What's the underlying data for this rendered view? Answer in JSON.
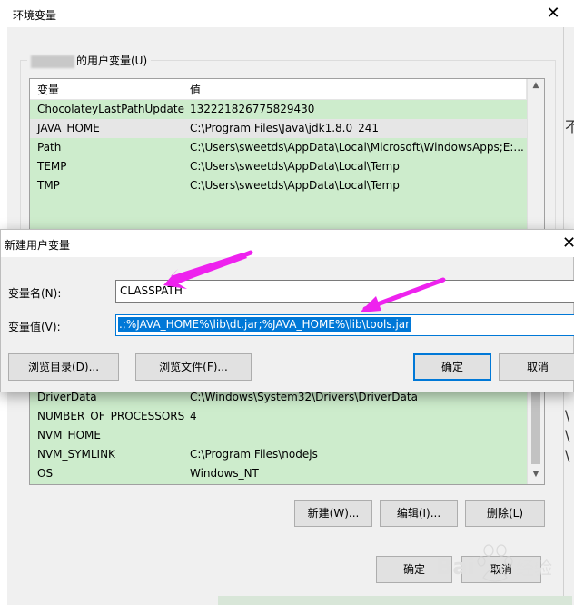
{
  "env_window": {
    "title": "环境变量",
    "close_glyph": "✕",
    "user_group_label": "的用户变量(U)",
    "user_list": {
      "headers": [
        "变量",
        "值"
      ],
      "rows": [
        {
          "name": "ChocolateyLastPathUpdate",
          "value": "132221826775829430"
        },
        {
          "name": "JAVA_HOME",
          "value": "C:\\Program Files\\Java\\jdk1.8.0_241"
        },
        {
          "name": "Path",
          "value": "C:\\Users\\sweetds\\AppData\\Local\\Microsoft\\WindowsApps;E:..."
        },
        {
          "name": "TEMP",
          "value": "C:\\Users\\sweetds\\AppData\\Local\\Temp"
        },
        {
          "name": "TMP",
          "value": "C:\\Users\\sweetds\\AppData\\Local\\Temp"
        }
      ]
    },
    "system_list": {
      "rows": [
        {
          "name": "DriverData",
          "value": "C:\\Windows\\System32\\Drivers\\DriverData"
        },
        {
          "name": "NUMBER_OF_PROCESSORS",
          "value": "4"
        },
        {
          "name": "NVM_HOME",
          "value": ""
        },
        {
          "name": "NVM_SYMLINK",
          "value": "C:\\Program Files\\nodejs"
        },
        {
          "name": "OS",
          "value": "Windows_NT"
        }
      ]
    },
    "system_buttons": {
      "new": "新建(W)...",
      "edit": "编辑(I)...",
      "delete": "删除(L)"
    },
    "ok": "确定",
    "cancel": "取消",
    "right_strip_glyphs": [
      "不",
      "\\",
      "\\",
      "\\"
    ]
  },
  "new_var_dialog": {
    "title": "新建用户变量",
    "close_glyph": "✕",
    "name_label": "变量名(N):",
    "name_value": "CLASSPATH",
    "value_label": "变量值(V):",
    "value_value": ".;%JAVA_HOME%\\lib\\dt.jar;%JAVA_HOME%\\lib\\tools.jar",
    "browse_dir": "浏览目录(D)...",
    "browse_file": "浏览文件(F)...",
    "ok": "确定",
    "cancel": "取消"
  },
  "colors": {
    "list_bg": "#cdeccc",
    "accent": "#0078d7",
    "arrow": "#ee22ee"
  },
  "watermark": {
    "text": "Bai",
    "text2": "经验"
  }
}
